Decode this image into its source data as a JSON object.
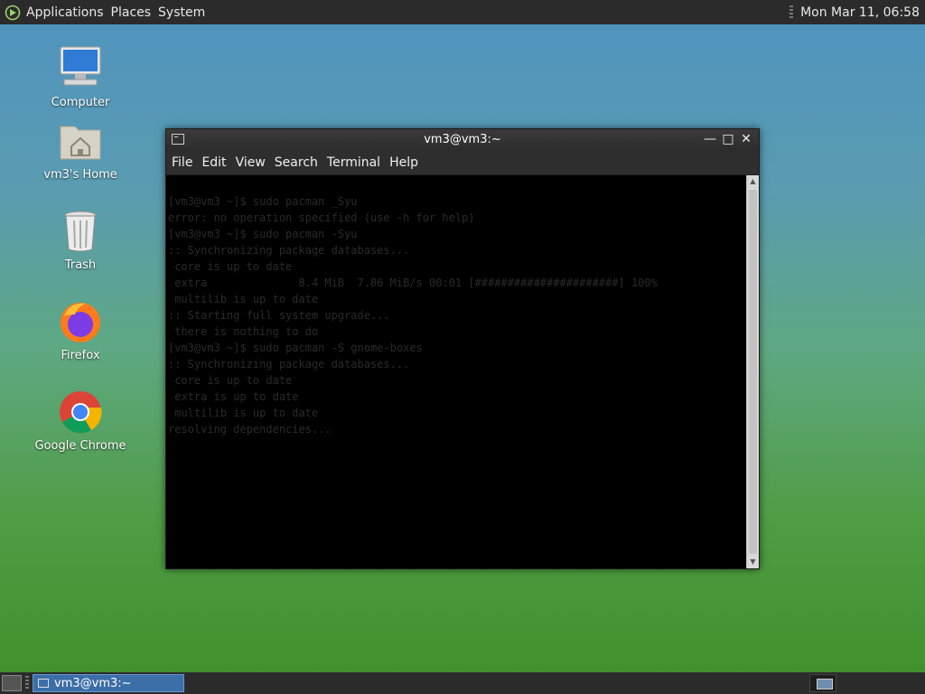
{
  "top_panel": {
    "menus": [
      "Applications",
      "Places",
      "System"
    ],
    "clock": "Mon Mar 11, 06:58"
  },
  "desktop": {
    "icons": [
      {
        "label": "Computer",
        "icon": "computer-icon"
      },
      {
        "label": "vm3's Home",
        "icon": "home-folder-icon"
      },
      {
        "label": "Trash",
        "icon": "trash-icon"
      },
      {
        "label": "Firefox",
        "icon": "firefox-icon"
      },
      {
        "label": "Google Chrome",
        "icon": "chrome-icon"
      }
    ]
  },
  "window": {
    "title": "vm3@vm3:~",
    "menu": [
      "File",
      "Edit",
      "View",
      "Search",
      "Terminal",
      "Help"
    ],
    "terminal_lines": [
      "[vm3@vm3 ~]$ sudo pacman _Syu",
      "error: no operation specified (use -h for help)",
      "[vm3@vm3 ~]$ sudo pacman -Syu",
      ":: Synchronizing package databases...",
      " core is up to date",
      " extra              8.4 MiB  7.86 MiB/s 00:01 [######################] 100%",
      " multilib is up to date",
      ":: Starting full system upgrade...",
      " there is nothing to do",
      "[vm3@vm3 ~]$ sudo pacman -S gnome-boxes",
      ":: Synchronizing package databases...",
      " core is up to date",
      " extra is up to date",
      " multilib is up to date",
      "resolving dependencies..."
    ]
  },
  "taskbar": {
    "task_label": "vm3@vm3:~"
  },
  "colors": {
    "panel": "#2b2b2b",
    "terminal_bg": "#000000",
    "task_active": "#3c6ea8"
  }
}
